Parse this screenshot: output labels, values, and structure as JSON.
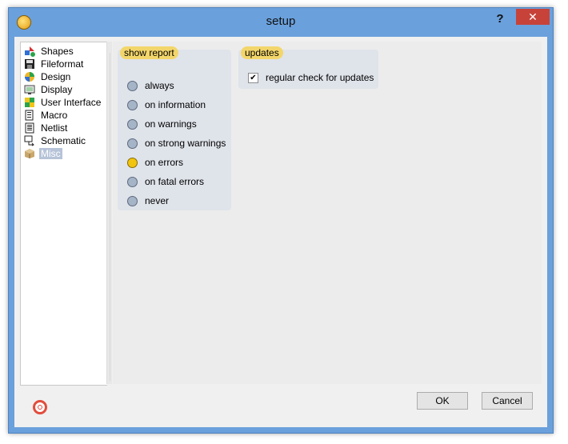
{
  "window": {
    "title": "setup",
    "help_label": "?",
    "close_label": "✕"
  },
  "tree": {
    "items": [
      {
        "label": "Shapes",
        "icon": "shapes-icon"
      },
      {
        "label": "Fileformat",
        "icon": "floppy-icon"
      },
      {
        "label": "Design",
        "icon": "design-icon"
      },
      {
        "label": "Display",
        "icon": "display-icon"
      },
      {
        "label": "User Interface",
        "icon": "user-interface-icon"
      },
      {
        "label": "Macro",
        "icon": "macro-icon"
      },
      {
        "label": "Netlist",
        "icon": "netlist-icon"
      },
      {
        "label": "Schematic",
        "icon": "schematic-icon"
      },
      {
        "label": "Misc",
        "icon": "box-icon",
        "selected": true
      }
    ]
  },
  "show_report": {
    "title": "show report",
    "options": [
      {
        "label": "always",
        "selected": false
      },
      {
        "label": "on information",
        "selected": false
      },
      {
        "label": "on warnings",
        "selected": false
      },
      {
        "label": "on strong warnings",
        "selected": false
      },
      {
        "label": "on errors",
        "selected": true
      },
      {
        "label": "on fatal errors",
        "selected": false
      },
      {
        "label": "never",
        "selected": false
      }
    ]
  },
  "updates": {
    "title": "updates",
    "check_label": "regular check for updates",
    "checked": true,
    "check_mark": "✔"
  },
  "footer": {
    "ok_label": "OK",
    "cancel_label": "Cancel",
    "help_icon": "lifebuoy-icon"
  }
}
